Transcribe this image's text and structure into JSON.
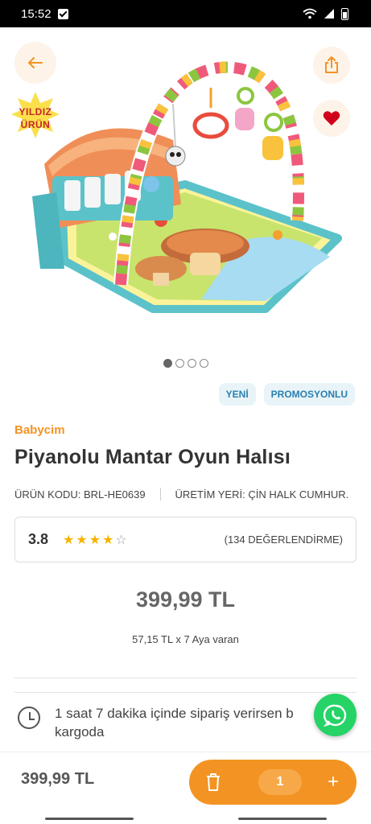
{
  "status_bar": {
    "time": "15:52"
  },
  "badge": {
    "line1": "YILDIZ",
    "line2": "ÜRÜN"
  },
  "icons": {
    "back": "arrow-left-icon",
    "share": "share-icon",
    "favorite": "heart-icon",
    "delivery": "clock-icon",
    "whatsapp": "whatsapp-icon",
    "trash": "trash-icon"
  },
  "gallery": {
    "pages": 4,
    "active": 1
  },
  "tags": [
    "YENİ",
    "PROMOSYONLU"
  ],
  "product": {
    "brand": "Babycim",
    "title": "Piyanolu Mantar Oyun Halısı",
    "code": "ÜRÜN KODU: BRL-HE0639",
    "origin": "ÜRETİM YERİ: ÇİN HALK CUMHUR."
  },
  "rating": {
    "score": "3.8",
    "stars_filled": 4,
    "stars_total": 5,
    "count": "(134 DEĞERLENDİRME)"
  },
  "price": {
    "main": "399,99 TL",
    "installment": "57,15 TL x 7 Aya varan"
  },
  "delivery": {
    "text": "1 saat 7 dakika içinde sipariş verirsen b",
    "text2": "kargoda"
  },
  "bottom": {
    "price": "399,99 TL",
    "quantity": "1",
    "plus": "+"
  },
  "colors": {
    "accent": "#f39323",
    "brand": "#f39323",
    "heart": "#d0021b",
    "whatsapp": "#25d366",
    "tag_text": "#2a7fb0",
    "tag_bg": "#e8f4f8"
  }
}
